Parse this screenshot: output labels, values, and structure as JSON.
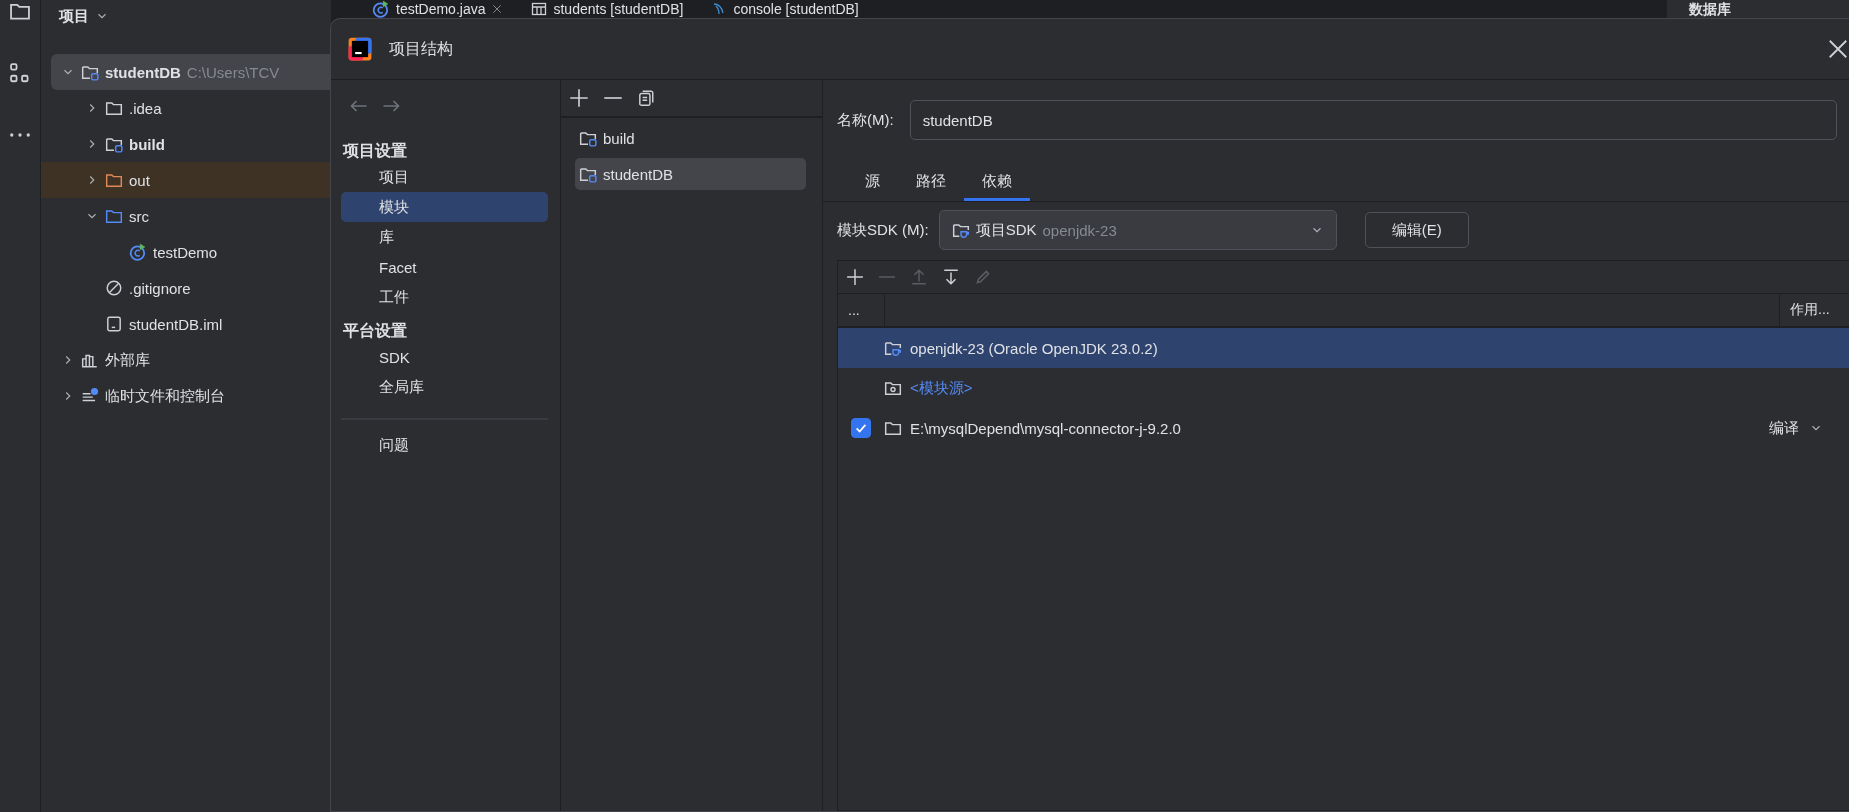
{
  "project_panel": {
    "title": "项目",
    "tree": [
      {
        "label": "studentDB",
        "path": "C:\\Users\\TCV",
        "kind": "module",
        "expanded": true,
        "selected": true,
        "children": [
          {
            "label": ".idea",
            "kind": "folder",
            "expanded": false,
            "selected": false
          },
          {
            "label": "build",
            "kind": "module",
            "expanded": false,
            "selected": false
          },
          {
            "label": "out",
            "kind": "excluded",
            "expanded": false,
            "selected": false
          },
          {
            "label": "src",
            "kind": "source",
            "expanded": true,
            "selected": false,
            "children": [
              {
                "label": "testDemo",
                "kind": "class",
                "selected": false
              }
            ]
          },
          {
            "label": ".gitignore",
            "kind": "ignored",
            "selected": false
          },
          {
            "label": "studentDB.iml",
            "kind": "file",
            "selected": false
          }
        ]
      },
      {
        "label": "外部库",
        "kind": "libraries",
        "expanded": false,
        "selected": false
      },
      {
        "label": "临时文件和控制台",
        "kind": "scratches",
        "expanded": false,
        "selected": false
      }
    ]
  },
  "editor_tabs": [
    {
      "label": "testDemo.java",
      "kind": "class",
      "closable": true
    },
    {
      "label": "students [studentDB]",
      "kind": "table",
      "closable": false
    },
    {
      "label": "console [studentDB]",
      "kind": "console",
      "closable": false
    }
  ],
  "right_panel": {
    "title": "数据库"
  },
  "dialog": {
    "title": "项目结构",
    "nav": {
      "sections": [
        {
          "heading": "项目设置",
          "items": [
            {
              "label": "项目",
              "selected": false
            },
            {
              "label": "模块",
              "selected": true
            },
            {
              "label": "库",
              "selected": false
            },
            {
              "label": "Facet",
              "selected": false
            },
            {
              "label": "工件",
              "selected": false
            }
          ]
        },
        {
          "heading": "平台设置",
          "items": [
            {
              "label": "SDK",
              "selected": false
            },
            {
              "label": "全局库",
              "selected": false
            }
          ]
        }
      ],
      "extra": [
        {
          "label": "问题",
          "selected": false
        }
      ]
    },
    "modules": [
      {
        "label": "build",
        "selected": false
      },
      {
        "label": "studentDB",
        "selected": true
      }
    ],
    "name_field": {
      "label": "名称(M):",
      "value": "studentDB"
    },
    "tabs": [
      {
        "label": "源",
        "selected": false
      },
      {
        "label": "路径",
        "selected": false
      },
      {
        "label": "依赖",
        "selected": true
      }
    ],
    "sdk": {
      "label": "模块SDK (M):",
      "value": "项目SDK",
      "hint": "openjdk-23",
      "button": "编辑(E)"
    },
    "toolbar": [
      {
        "kind": "add",
        "disabled": false
      },
      {
        "kind": "remove",
        "disabled": true
      },
      {
        "kind": "up",
        "disabled": true
      },
      {
        "kind": "down",
        "disabled": false
      },
      {
        "kind": "edit",
        "disabled": true
      }
    ],
    "columns": [
      "...",
      "作用..."
    ],
    "rows": [
      {
        "kind": "sdk",
        "label": "openjdk-23 (Oracle OpenJDK 23.0.2)",
        "selected": true
      },
      {
        "kind": "source",
        "label": "<模块源>",
        "selected": false
      },
      {
        "kind": "library",
        "label": "E:\\mysqlDepend\\mysql-connector-j-9.2.0",
        "checked": true,
        "scope": "编译",
        "selected": false
      }
    ]
  }
}
